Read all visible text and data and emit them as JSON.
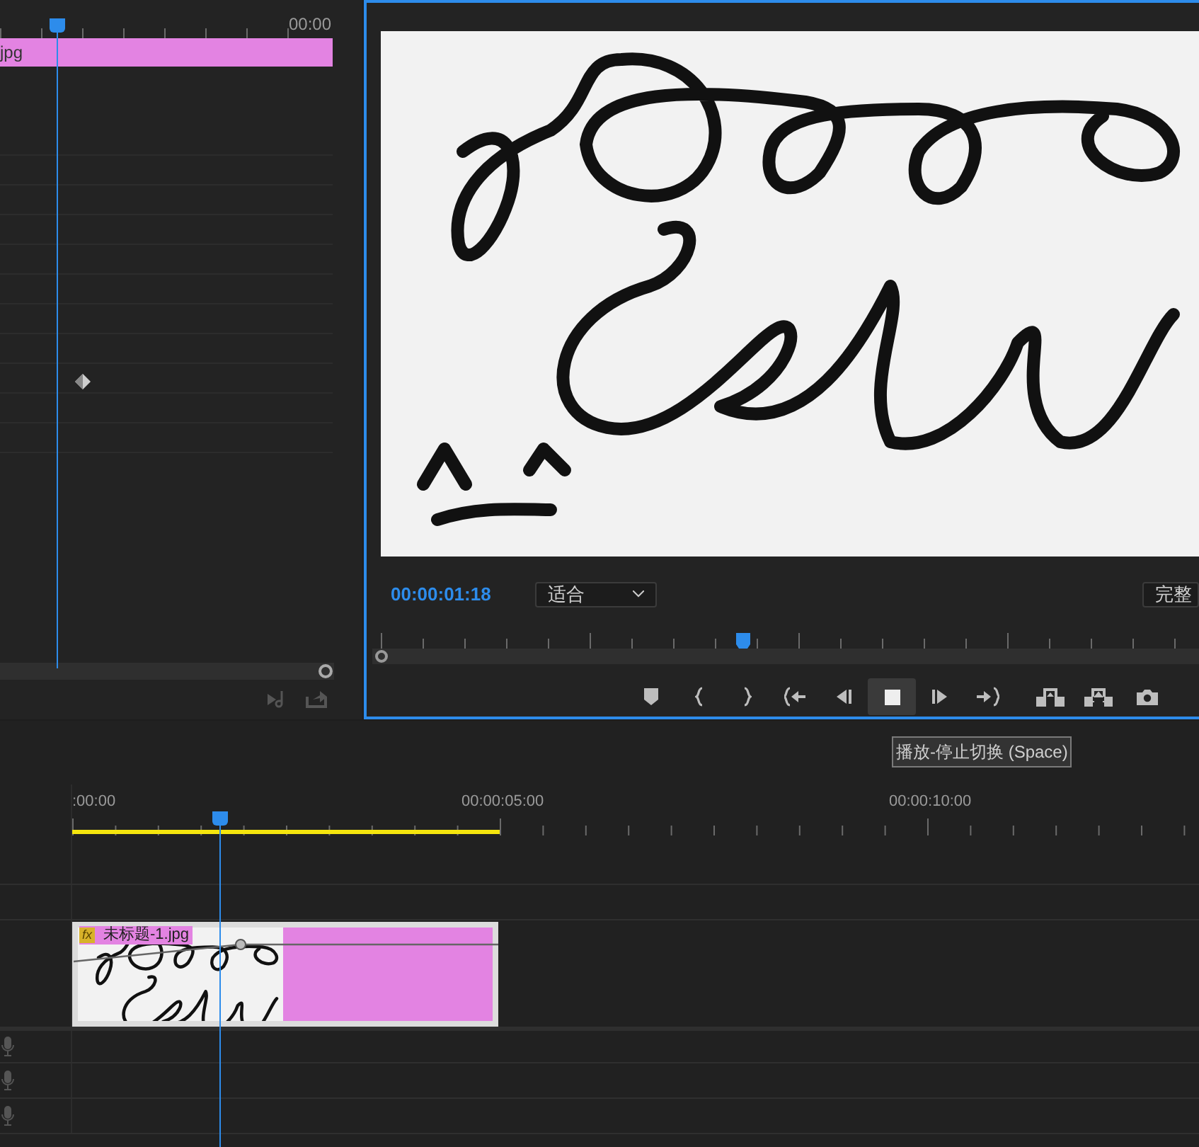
{
  "effect_controls": {
    "ruler_time": "00:00",
    "clip_label": "jpg"
  },
  "program_monitor": {
    "timecode": "00:00:01:18",
    "zoom_select": "适合",
    "quality_select": "完整",
    "transport_buttons": [
      {
        "kind": "marker",
        "highlighted": false
      },
      {
        "kind": "mark-in",
        "highlighted": false
      },
      {
        "kind": "mark-out",
        "highlighted": false
      },
      {
        "kind": "go-to-in",
        "highlighted": false
      },
      {
        "kind": "step-back",
        "highlighted": false
      },
      {
        "kind": "stop",
        "highlighted": true
      },
      {
        "kind": "step-forward",
        "highlighted": false
      },
      {
        "kind": "go-to-out",
        "highlighted": false
      },
      {
        "kind": "lift",
        "highlighted": false
      },
      {
        "kind": "extract",
        "highlighted": false
      },
      {
        "kind": "camera",
        "highlighted": false
      }
    ]
  },
  "tooltip": "播放-停止切换 (Space)",
  "timeline": {
    "ruler_labels": [
      ":00:00",
      "00:00:05:00",
      "00:00:10:00"
    ],
    "tracks": [
      {
        "kind": "video"
      },
      {
        "kind": "video"
      },
      {
        "kind": "clip",
        "clip_badge": "fx",
        "clip_name": "未标题-1.jpg"
      },
      {
        "kind": "audio"
      },
      {
        "kind": "audio"
      },
      {
        "kind": "audio"
      }
    ]
  }
}
